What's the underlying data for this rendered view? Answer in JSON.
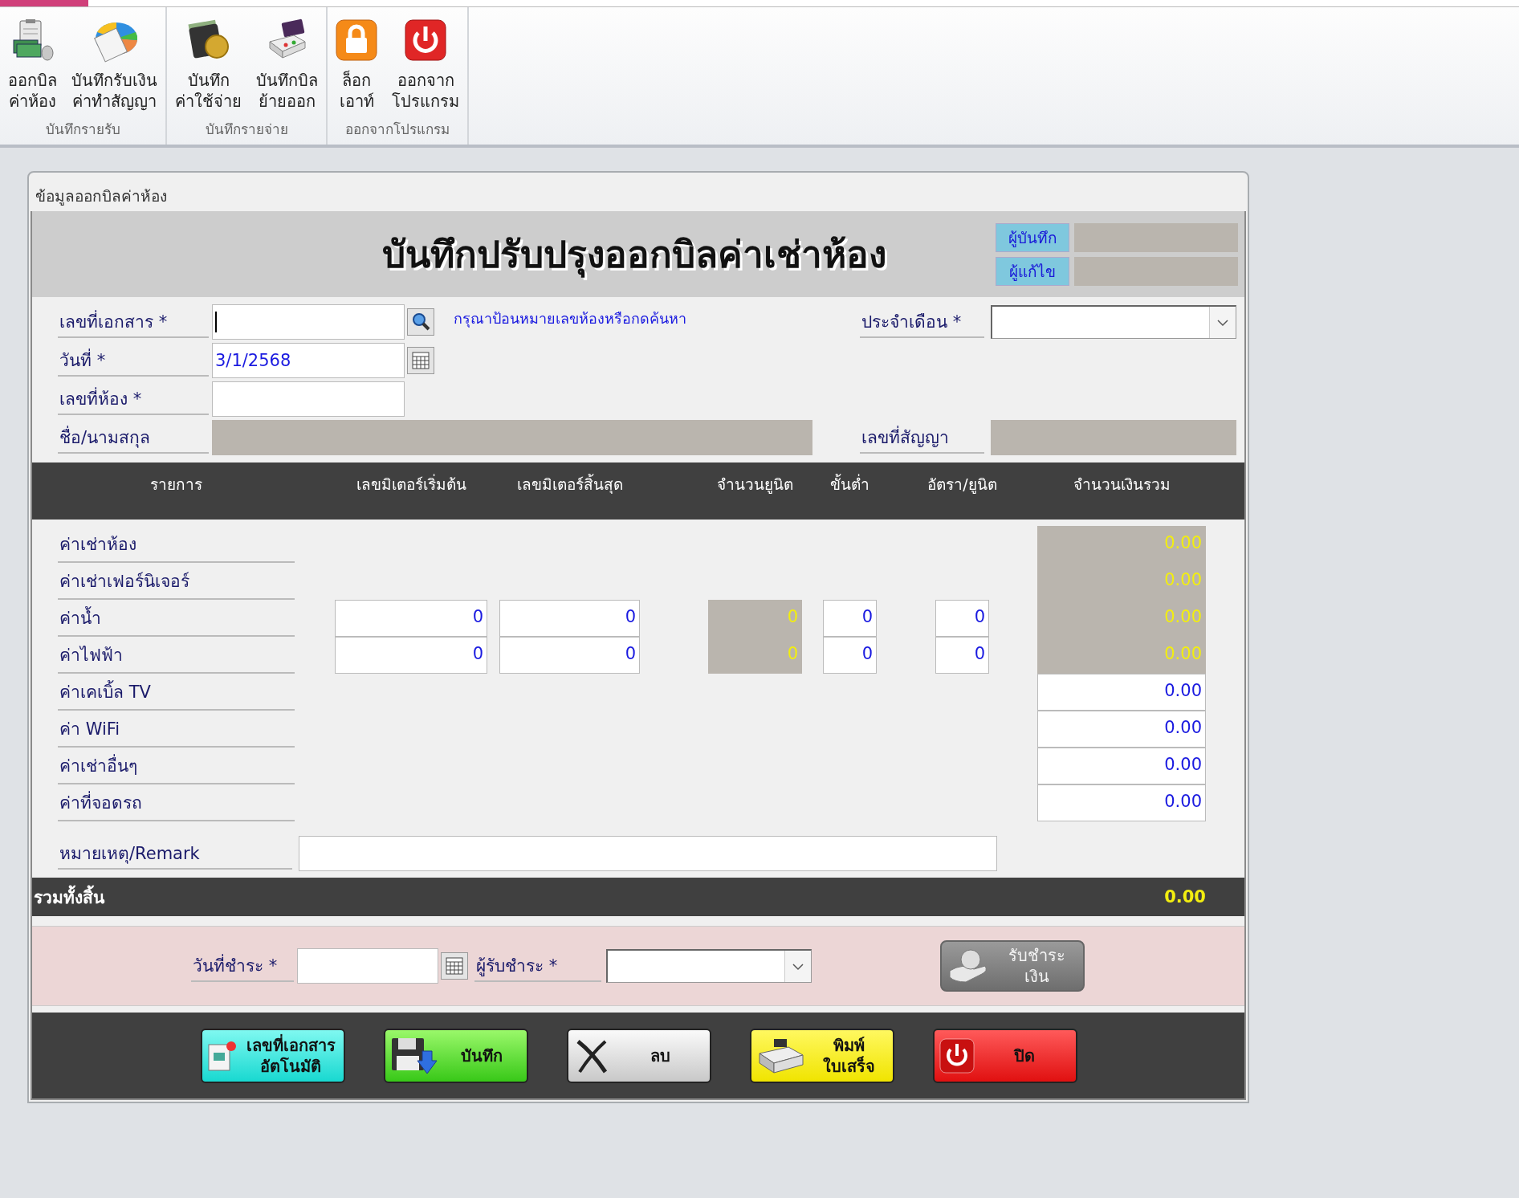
{
  "ribbon": {
    "groups": [
      {
        "label": "บันทึกรายรับ",
        "buttons": [
          {
            "kind": "bill",
            "lines": [
              "ออกบิล",
              "ค่าห้อง"
            ]
          },
          {
            "kind": "calculator",
            "lines": [
              "บันทึกรับเงิน",
              "ค่าทำสัญญา"
            ]
          }
        ]
      },
      {
        "label": "บันทึกรายจ่าย",
        "buttons": [
          {
            "kind": "wallet",
            "lines": [
              "บันทึก",
              "ค่าใช้จ่าย"
            ]
          },
          {
            "kind": "register",
            "lines": [
              "บันทึกบิล",
              "ย้ายออก"
            ]
          }
        ]
      },
      {
        "label": "ออกจากโปรแกรม",
        "buttons": [
          {
            "kind": "lock",
            "lines": [
              "ล็อก",
              "เอาท์"
            ]
          },
          {
            "kind": "power",
            "lines": [
              "ออกจาก",
              "โปรแกรม"
            ]
          }
        ]
      }
    ]
  },
  "form": {
    "panel_title": "ข้อมูลออกบิลค่าห้อง",
    "title": "บันทึกปรับปรุงออกบิลค่าเช่าห้อง",
    "audit": [
      {
        "label": "ผู้บันทึก"
      },
      {
        "label": "ผู้แก้ไข"
      }
    ],
    "document_no": {
      "label": "เลขที่เอกสาร *",
      "focused": true
    },
    "hint": "กรุณาป้อนหมายเลขห้องหรือกดค้นหา",
    "month": {
      "label": "ประจำเดือน *"
    },
    "date": {
      "label": "วันที่ *",
      "value": "3/1/2568"
    },
    "room": {
      "label": "เลขที่ห้อง *"
    },
    "name": {
      "label": "ชื่อ/นามสกุล"
    },
    "contract": {
      "label": "เลขที่สัญญา"
    },
    "columns": [
      "รายการ",
      "เลขมิเตอร์เริ่มต้น",
      "เลขมิเตอร์สิ้นสุด",
      "จำนวนยูนิต",
      "ขั้นต่ำ",
      "อัตรา/ยูนิต",
      "จำนวนเงินรวม"
    ],
    "items": [
      {
        "kind": "amount",
        "label": "ค่าเช่าห้อง",
        "total": "0.00",
        "total_readonly": true
      },
      {
        "kind": "amount",
        "label": "ค่าเช่าเฟอร์นิเจอร์",
        "total": "0.00",
        "total_readonly": true
      },
      {
        "kind": "meter",
        "label": "ค่าน้ำ",
        "start": "0",
        "end": "0",
        "units": "0",
        "minimum": "0",
        "rate": "0",
        "total": "0.00",
        "total_readonly": true
      },
      {
        "kind": "meter",
        "label": "ค่าไฟฟ้า",
        "start": "0",
        "end": "0",
        "units": "0",
        "minimum": "0",
        "rate": "0",
        "total": "0.00",
        "total_readonly": true
      },
      {
        "kind": "amount",
        "label": "ค่าเคเบิ้ล TV",
        "total": "0.00",
        "total_readonly": false
      },
      {
        "kind": "amount",
        "label": "ค่า WiFi",
        "total": "0.00",
        "total_readonly": false
      },
      {
        "kind": "amount",
        "label": "ค่าเช่าอื่นๆ",
        "total": "0.00",
        "total_readonly": false
      },
      {
        "kind": "amount",
        "label": "ค่าที่จอดรถ",
        "total": "0.00",
        "total_readonly": false
      }
    ],
    "remark": {
      "label": "หมายเหตุ/Remark"
    },
    "grand_total": {
      "label": "รวมทั้งสิ้น",
      "value": "0.00"
    },
    "payment": {
      "date_label": "วันที่ชำระ *",
      "receiver_label": "ผู้รับชำระ *",
      "receive_button": {
        "lines": [
          "รับชำระ",
          "เงิน"
        ],
        "disabled": true
      }
    },
    "actions": [
      {
        "kind": "auto_number",
        "lines": [
          "เลขที่เอกสาร",
          "อัตโนมัติ"
        ]
      },
      {
        "kind": "save",
        "lines": [
          "บันทึก"
        ]
      },
      {
        "kind": "delete",
        "lines": [
          "ลบ"
        ]
      },
      {
        "kind": "print",
        "lines": [
          "พิมพ์",
          "ใบเสร็จ"
        ]
      },
      {
        "kind": "close",
        "lines": [
          "ปิด"
        ]
      }
    ]
  }
}
